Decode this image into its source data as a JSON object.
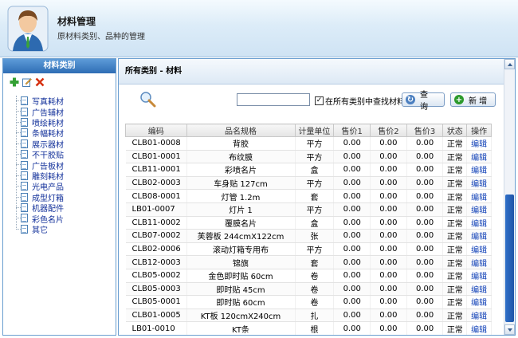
{
  "header": {
    "title": "材料管理",
    "subtitle": "原材料类别、品种的管理"
  },
  "sidebar": {
    "title": "材料类别",
    "tools": [
      "add-icon",
      "edit-icon",
      "delete-icon"
    ],
    "items": [
      {
        "label": "写真耗材"
      },
      {
        "label": "广告辅材"
      },
      {
        "label": "喷绘耗材"
      },
      {
        "label": "条幅耗材"
      },
      {
        "label": "展示器材"
      },
      {
        "label": "不干胶贴"
      },
      {
        "label": "广告板材"
      },
      {
        "label": "雕刻耗材"
      },
      {
        "label": "光电产品"
      },
      {
        "label": "成型灯箱"
      },
      {
        "label": "机器配件"
      },
      {
        "label": "彩色名片"
      },
      {
        "label": "其它"
      }
    ]
  },
  "main": {
    "breadcrumb": "所有类别 - 材料",
    "search": {
      "value": "",
      "placeholder": ""
    },
    "checkbox": {
      "label": "在所有类别中查找材料",
      "checked": true
    },
    "query_label": "查 询",
    "add_label": "新 增",
    "columns": [
      "编码",
      "品名规格",
      "计量单位",
      "售价1",
      "售价2",
      "售价3",
      "状态",
      "操作"
    ],
    "rows": [
      [
        "CLB01-0008",
        "背胶",
        "平方",
        "0.00",
        "0.00",
        "0.00",
        "正常",
        "编辑"
      ],
      [
        "CLB01-0001",
        "布纹膜",
        "平方",
        "0.00",
        "0.00",
        "0.00",
        "正常",
        "编辑"
      ],
      [
        "CLB11-0001",
        "彩喷名片",
        "盒",
        "0.00",
        "0.00",
        "0.00",
        "正常",
        "编辑"
      ],
      [
        "CLB02-0003",
        "车身贴 127cm",
        "平方",
        "0.00",
        "0.00",
        "0.00",
        "正常",
        "编辑"
      ],
      [
        "CLB08-0001",
        "灯管 1.2m",
        "套",
        "0.00",
        "0.00",
        "0.00",
        "正常",
        "编辑"
      ],
      [
        "LB01-0007",
        "灯片 1",
        "平方",
        "0.00",
        "0.00",
        "0.00",
        "正常",
        "编辑"
      ],
      [
        "CLB11-0002",
        "覆膜名片",
        "盒",
        "0.00",
        "0.00",
        "0.00",
        "正常",
        "编辑"
      ],
      [
        "CLB07-0002",
        "芙蓉板 244cmX122cm",
        "张",
        "0.00",
        "0.00",
        "0.00",
        "正常",
        "编辑"
      ],
      [
        "CLB02-0006",
        "滚动灯箱专用布",
        "平方",
        "0.00",
        "0.00",
        "0.00",
        "正常",
        "编辑"
      ],
      [
        "CLB12-0003",
        "锦旗",
        "套",
        "0.00",
        "0.00",
        "0.00",
        "正常",
        "编辑"
      ],
      [
        "CLB05-0002",
        "金色即时贴 60cm",
        "卷",
        "0.00",
        "0.00",
        "0.00",
        "正常",
        "编辑"
      ],
      [
        "CLB05-0003",
        "即时贴 45cm",
        "卷",
        "0.00",
        "0.00",
        "0.00",
        "正常",
        "编辑"
      ],
      [
        "CLB05-0001",
        "即时贴 60cm",
        "卷",
        "0.00",
        "0.00",
        "0.00",
        "正常",
        "编辑"
      ],
      [
        "CLB01-0005",
        "KT板 120cmX240cm",
        "扎",
        "0.00",
        "0.00",
        "0.00",
        "正常",
        "编辑"
      ],
      [
        "LB01-0010",
        "KT条",
        "根",
        "0.00",
        "0.00",
        "0.00",
        "正常",
        "编辑"
      ]
    ]
  },
  "colors": {
    "sidebar_header": "#2e6db4",
    "link": "#1343b8",
    "scroll_thumb": "#2f6fc8"
  }
}
